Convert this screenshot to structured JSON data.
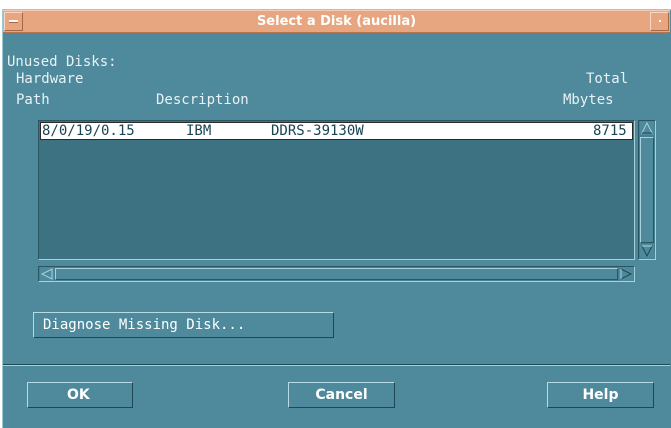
{
  "window": {
    "title": "Select a Disk (aucilla)"
  },
  "section_label": "Unused Disks:",
  "columns": {
    "hardware_path_line1": "Hardware",
    "hardware_path_line2": "Path",
    "description": "Description",
    "total_line1": "Total",
    "total_line2": "Mbytes"
  },
  "disks": [
    {
      "path": "8/0/19/0.15",
      "vendor": "IBM",
      "model": "DDRS-39130W",
      "mbytes": "8715",
      "selected": true
    }
  ],
  "buttons": {
    "diagnose": "Diagnose Missing Disk...",
    "ok": "OK",
    "cancel": "Cancel",
    "help": "Help"
  },
  "colors": {
    "dialog_bg": "#4e8a9c",
    "titlebar_bg": "#e7a680",
    "list_bg": "#3c7282",
    "selected_row_bg": "#ffffff",
    "text": "#e8f2f5"
  },
  "icons": {
    "title_menu": "window-menu-icon",
    "title_resize": "window-resize-icon",
    "scroll_up": "triangle-up-icon",
    "scroll_down": "triangle-down-icon",
    "scroll_left": "triangle-left-icon",
    "scroll_right": "triangle-right-icon"
  }
}
